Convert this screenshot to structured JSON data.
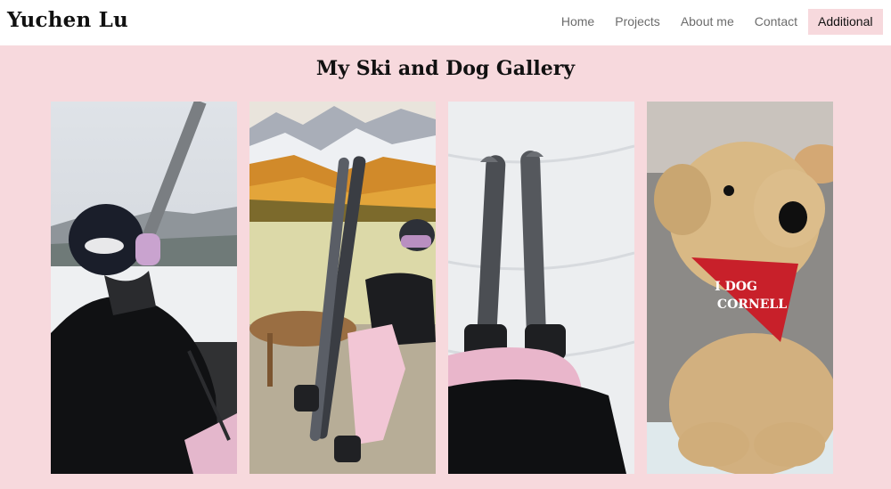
{
  "site": {
    "brand": "Yuchen Lu"
  },
  "nav": {
    "items": [
      {
        "label": "Home",
        "active": false
      },
      {
        "label": "Projects",
        "active": false
      },
      {
        "label": "About me",
        "active": false
      },
      {
        "label": "Contact",
        "active": false
      },
      {
        "label": "Additional",
        "active": true
      }
    ]
  },
  "gallery": {
    "title": "My Ski and Dog Gallery",
    "photos": [
      {
        "subject": "skier on chairlift in black helmet and goggles"
      },
      {
        "subject": "skier holding skis in front of autumn mountain view"
      },
      {
        "subject": "skis on snow viewed from above"
      },
      {
        "subject": "plush dog with red bandana",
        "bandana_text": "I DOG CORNELL"
      }
    ]
  },
  "colors": {
    "page_bg": "#f7d9dd",
    "navbar_bg": "#ffffff",
    "active_tab_bg": "#f7d9dd",
    "bandana": "#c8202a"
  }
}
